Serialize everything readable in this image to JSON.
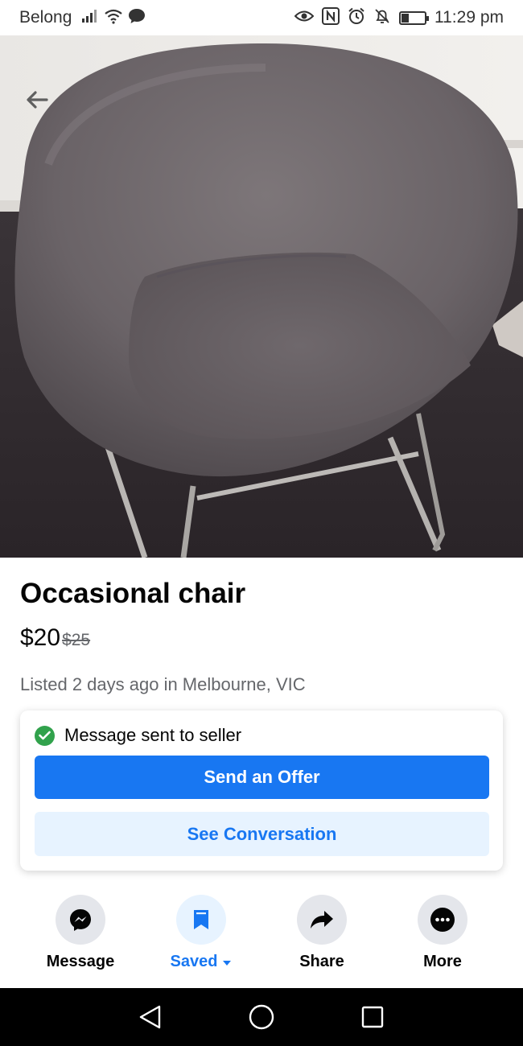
{
  "status_bar": {
    "carrier": "Belong",
    "time": "11:29 pm",
    "battery_level": 0.3,
    "icons": [
      "signal-icon",
      "wifi-icon",
      "chat-bubble-icon",
      "eye-icon",
      "nfc-icon",
      "alarm-icon",
      "bell-off-icon",
      "battery-icon"
    ]
  },
  "listing": {
    "image_alt": "Grey upholstered tub chair with metal sled legs on dark carpet",
    "back_icon": "arrow-left-icon",
    "title": "Occasional chair",
    "price": "$20",
    "original_price": "$25",
    "listed_info": "Listed 2 days ago in Melbourne, VIC"
  },
  "message_card": {
    "status_text": "Message sent to seller",
    "status_icon": "check-circle-icon",
    "primary_button": "Send an Offer",
    "secondary_button": "See Conversation"
  },
  "actions": [
    {
      "label": "Message",
      "icon": "messenger-icon",
      "active": false
    },
    {
      "label": "Saved",
      "icon": "bookmark-icon",
      "active": true
    },
    {
      "label": "Share",
      "icon": "share-arrow-icon",
      "active": false
    },
    {
      "label": "More",
      "icon": "more-dots-icon",
      "active": false
    }
  ],
  "colors": {
    "accent": "#1877f2",
    "accent_light": "#e7f3ff",
    "success": "#31a24c",
    "secondary_text": "#65676b"
  },
  "nav_bar": {
    "icons": [
      "back-triangle-icon",
      "home-circle-icon",
      "recents-square-icon"
    ]
  }
}
